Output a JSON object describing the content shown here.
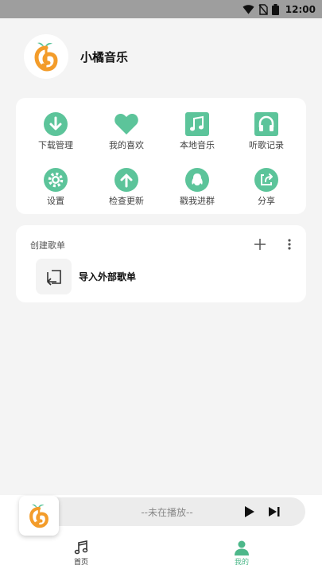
{
  "status_bar": {
    "time": "12:00"
  },
  "profile": {
    "app_name": "小橘音乐"
  },
  "grid": [
    {
      "label": "下载管理",
      "icon": "download-icon"
    },
    {
      "label": "我的喜欢",
      "icon": "heart-icon"
    },
    {
      "label": "本地音乐",
      "icon": "music-note-icon"
    },
    {
      "label": "听歌记录",
      "icon": "headphones-icon"
    },
    {
      "label": "设置",
      "icon": "gear-icon"
    },
    {
      "label": "检查更新",
      "icon": "arrow-up-icon"
    },
    {
      "label": "戳我进群",
      "icon": "qq-penguin-icon"
    },
    {
      "label": "分享",
      "icon": "share-icon"
    }
  ],
  "playlist": {
    "title": "创建歌单",
    "import_label": "导入外部歌单"
  },
  "player": {
    "status": "--未在播放--"
  },
  "tabs": {
    "home": "首页",
    "mine": "我的"
  },
  "colors": {
    "accent": "#5cc49a",
    "orange": "#f39c2a",
    "status_bar": "#9e9e9e"
  }
}
